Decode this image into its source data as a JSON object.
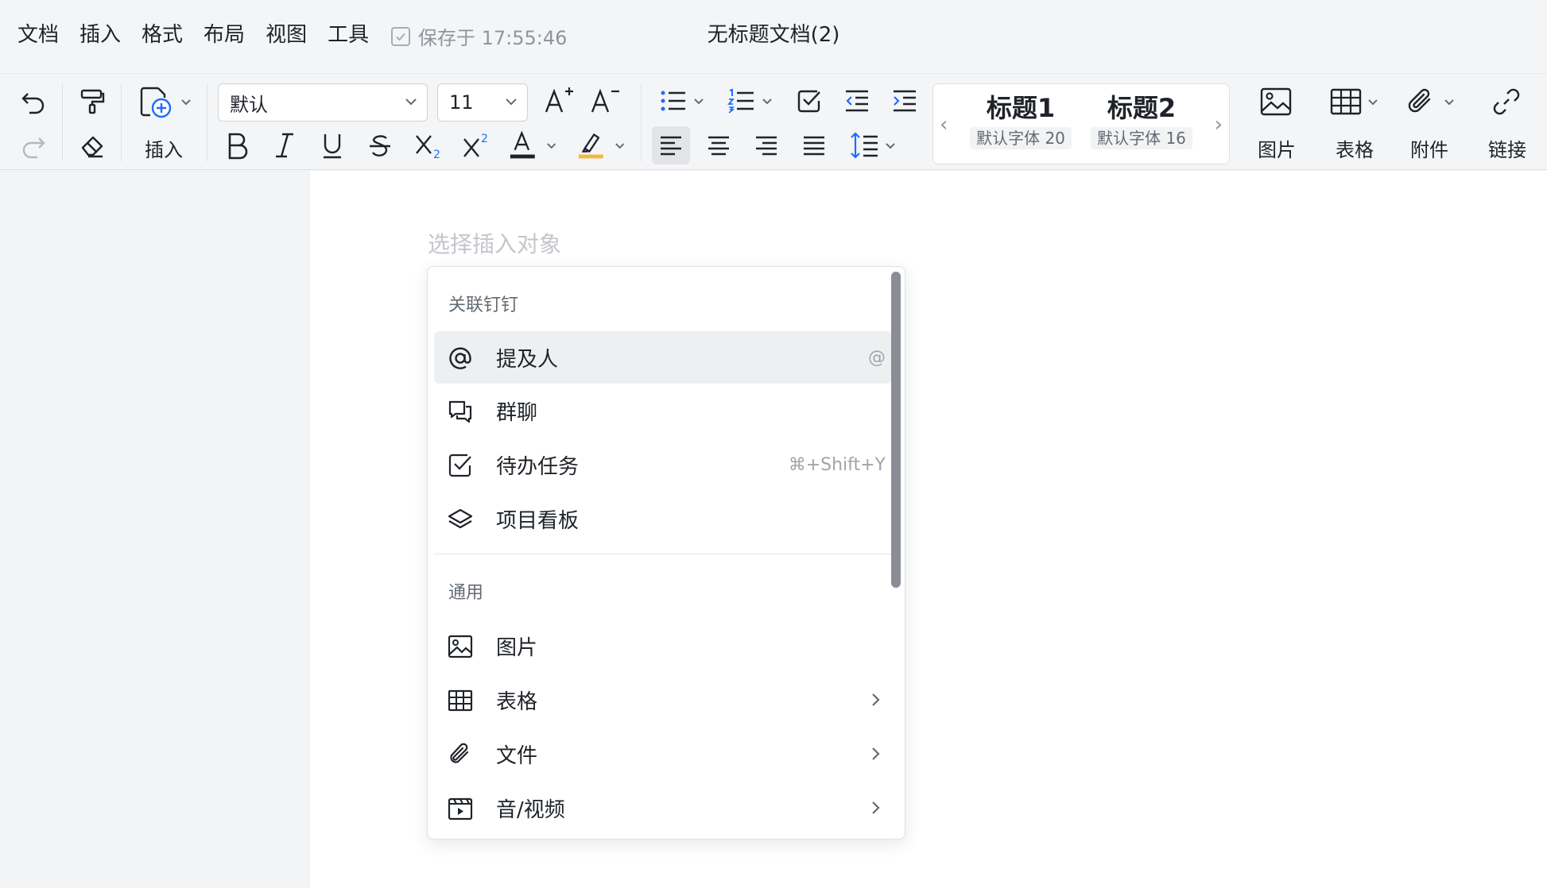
{
  "menu": {
    "items": [
      "文档",
      "插入",
      "格式",
      "布局",
      "视图",
      "工具"
    ]
  },
  "save_status": "保存于 17:55:46",
  "doc_title": "无标题文档(2)",
  "toolbar": {
    "insert_label": "插入",
    "font_family": "默认",
    "font_size": "11",
    "styles": [
      {
        "name": "标题1",
        "desc": "默认字体 20"
      },
      {
        "name": "标题2",
        "desc": "默认字体 16"
      }
    ],
    "image_label": "图片",
    "table_label": "表格",
    "attachment_label": "附件",
    "link_label": "链接",
    "font_color_hex": "#1f2329",
    "highlight_color_hex": "#f5b83d"
  },
  "editor": {
    "placeholder": "选择插入对象"
  },
  "popup": {
    "section1_title": "关联钉钉",
    "section1_items": [
      {
        "icon": "at-icon",
        "label": "提及人",
        "shortcut": "@"
      },
      {
        "icon": "group-chat-icon",
        "label": "群聊",
        "shortcut": ""
      },
      {
        "icon": "todo-icon",
        "label": "待办任务",
        "shortcut": "⌘+Shift+Y"
      },
      {
        "icon": "layers-icon",
        "label": "项目看板",
        "shortcut": ""
      }
    ],
    "section2_title": "通用",
    "section2_items": [
      {
        "icon": "image-icon",
        "label": "图片"
      },
      {
        "icon": "table-icon",
        "label": "表格"
      },
      {
        "icon": "paperclip-icon",
        "label": "文件"
      },
      {
        "icon": "video-icon",
        "label": "音/视频"
      }
    ]
  }
}
